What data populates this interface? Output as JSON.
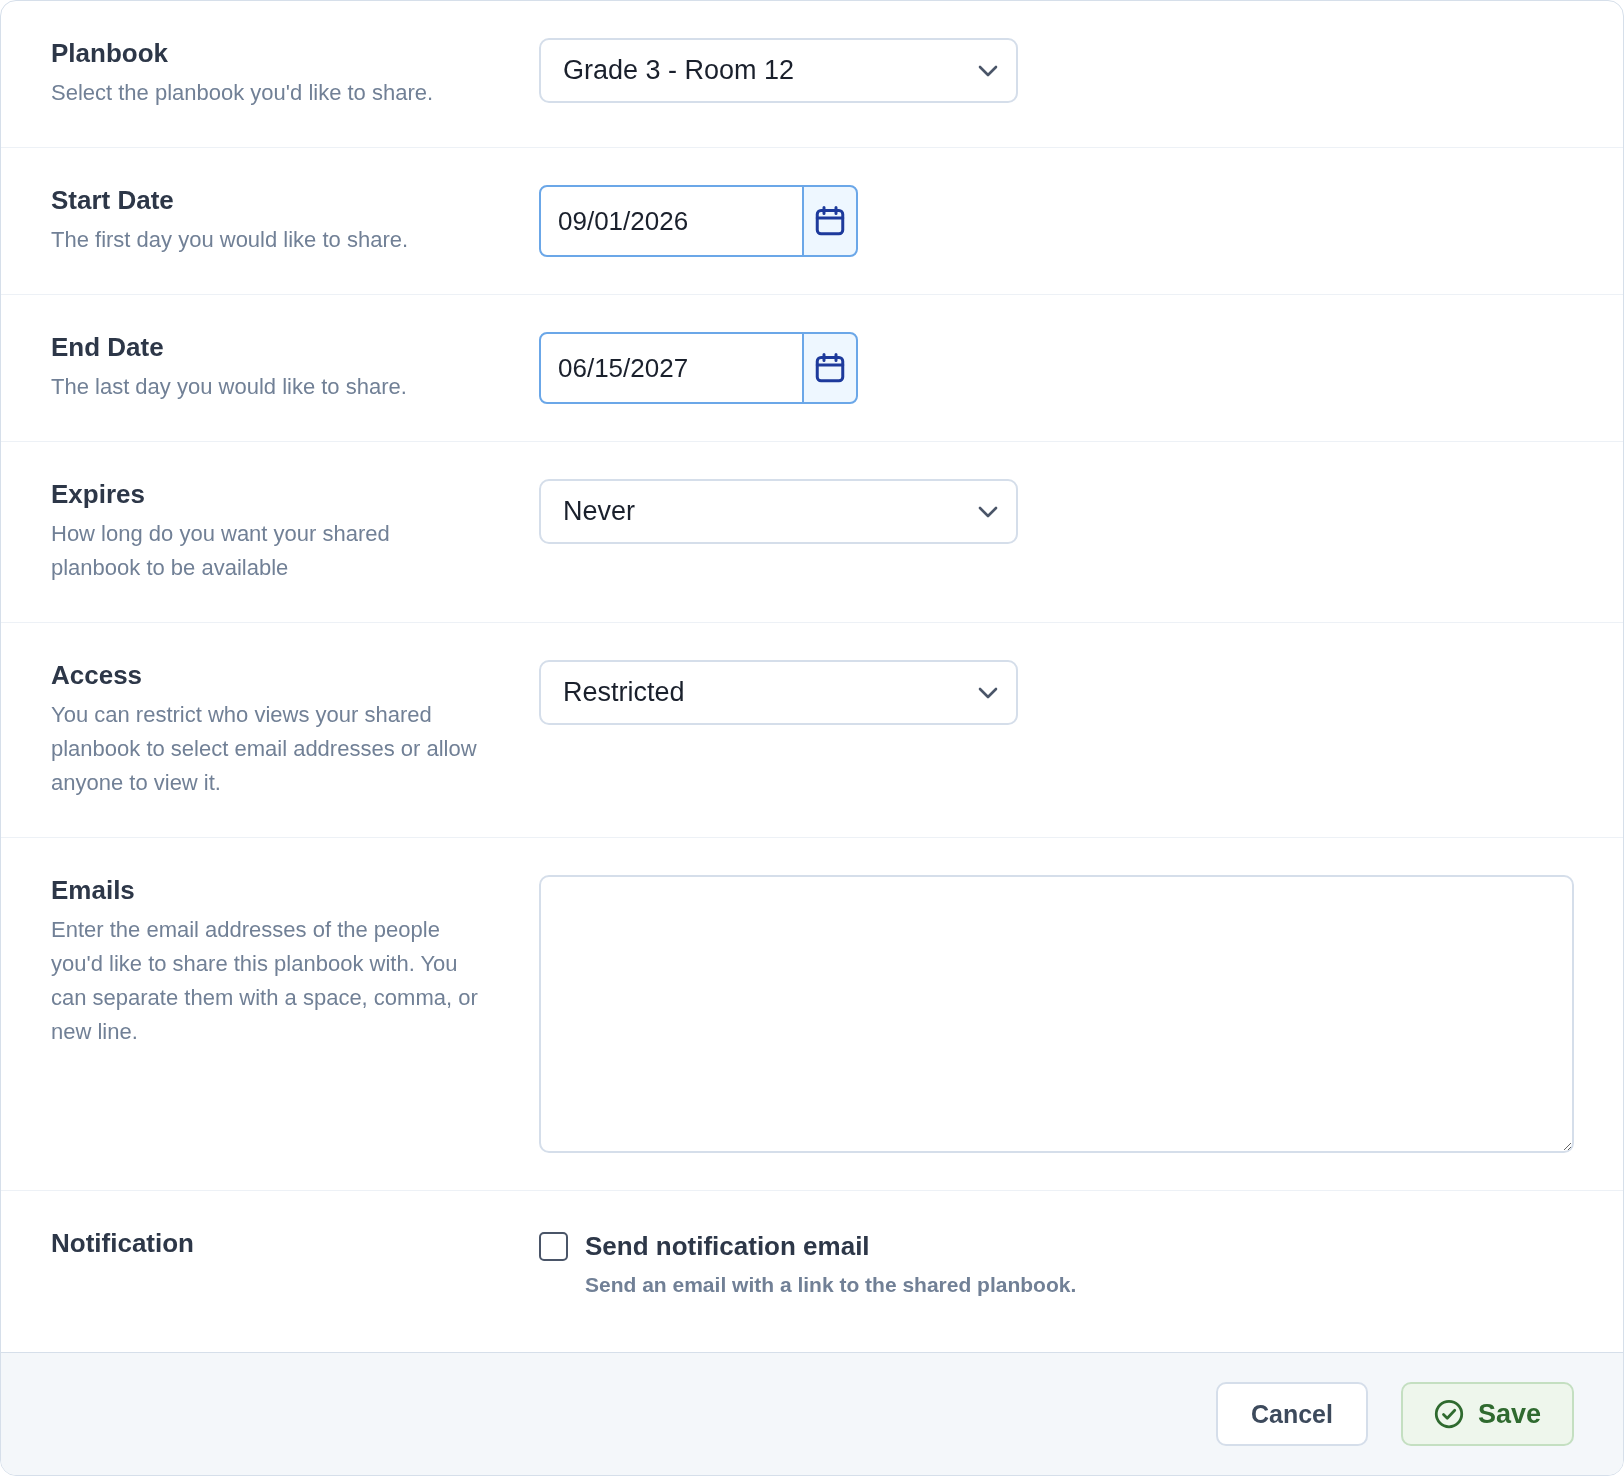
{
  "rows": [
    {
      "kind": "select",
      "label": "Planbook",
      "description": "Select the planbook you'd like to share.",
      "value": "Grade 3 - Room 12"
    },
    {
      "kind": "date",
      "label": "Start Date",
      "description": "The first day you would like to share.",
      "value": "09/01/2026"
    },
    {
      "kind": "date",
      "label": "End Date",
      "description": "The last day you would like to share.",
      "value": "06/15/2027"
    },
    {
      "kind": "select",
      "label": "Expires",
      "description": "How long do you want your shared planbook to be available",
      "value": "Never"
    },
    {
      "kind": "select",
      "label": "Access",
      "description": "You can restrict who views your shared planbook to select email addresses or allow anyone to view it.",
      "value": "Restricted"
    },
    {
      "kind": "textarea",
      "label": "Emails",
      "description": "Enter the email addresses of the people you'd like to share this planbook with. You can separate them with a space, comma, or new line."
    },
    {
      "kind": "checkbox",
      "label": "Notification",
      "option": "Send notification email",
      "hint": "Send an email with a link to the shared planbook.",
      "checked": false
    }
  ],
  "footer": {
    "buttons": [
      {
        "kind": "cancel",
        "label": "Cancel"
      },
      {
        "kind": "save",
        "label": "Save"
      }
    ]
  }
}
